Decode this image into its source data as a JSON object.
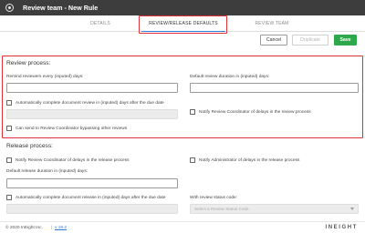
{
  "window": {
    "title": "Review team - New Rule",
    "icon": "gear-icon"
  },
  "tabs": [
    {
      "label": "DETAILS"
    },
    {
      "label": "REVIEW/RELEASE DEFAULTS",
      "active": true
    },
    {
      "label": "REVIEW TEAM"
    }
  ],
  "actions": {
    "cancel": "Cancel",
    "duplicate": "Duplicate",
    "save": "Save"
  },
  "colors": {
    "save": "#2da84a",
    "highlight": "#e0303a",
    "titlebar": "#3d3d3d",
    "link": "#2d7bd6"
  },
  "review": {
    "title": "Review process:",
    "remind_label": "Remind reviewers every (inputed) days:",
    "remind_value": "",
    "default_duration_label": "Default review duration in (inputed) days:",
    "default_duration_value": "",
    "auto_complete_label": "Automatically complete document review in (inputed) days after the due date",
    "auto_complete_value": "",
    "notify_coordinator_label": "Notify Review Coordinator of delays in the review process",
    "send_to_coordinator_label": "Can send to Review Coordinator bypassing other reviews"
  },
  "release": {
    "title": "Release process:",
    "notify_coordinator_label": "Notify Review Coordinator of delays in the release process",
    "notify_admin_label": "Notify Administrator of delays in the release process",
    "default_duration_label": "Default release duration in (inputed) days:",
    "default_duration_value": "",
    "auto_complete_label": "Automatically complete document release in (inputed) days after the due date",
    "auto_complete_value": "",
    "status_code_label": "With review status code:",
    "status_code_placeholder": "Select a Review Status Code"
  },
  "footer": {
    "copyright": "© 2020 InEight Inc.",
    "separator": "|",
    "version": "v 19.2",
    "brand": "INEIGHT"
  }
}
